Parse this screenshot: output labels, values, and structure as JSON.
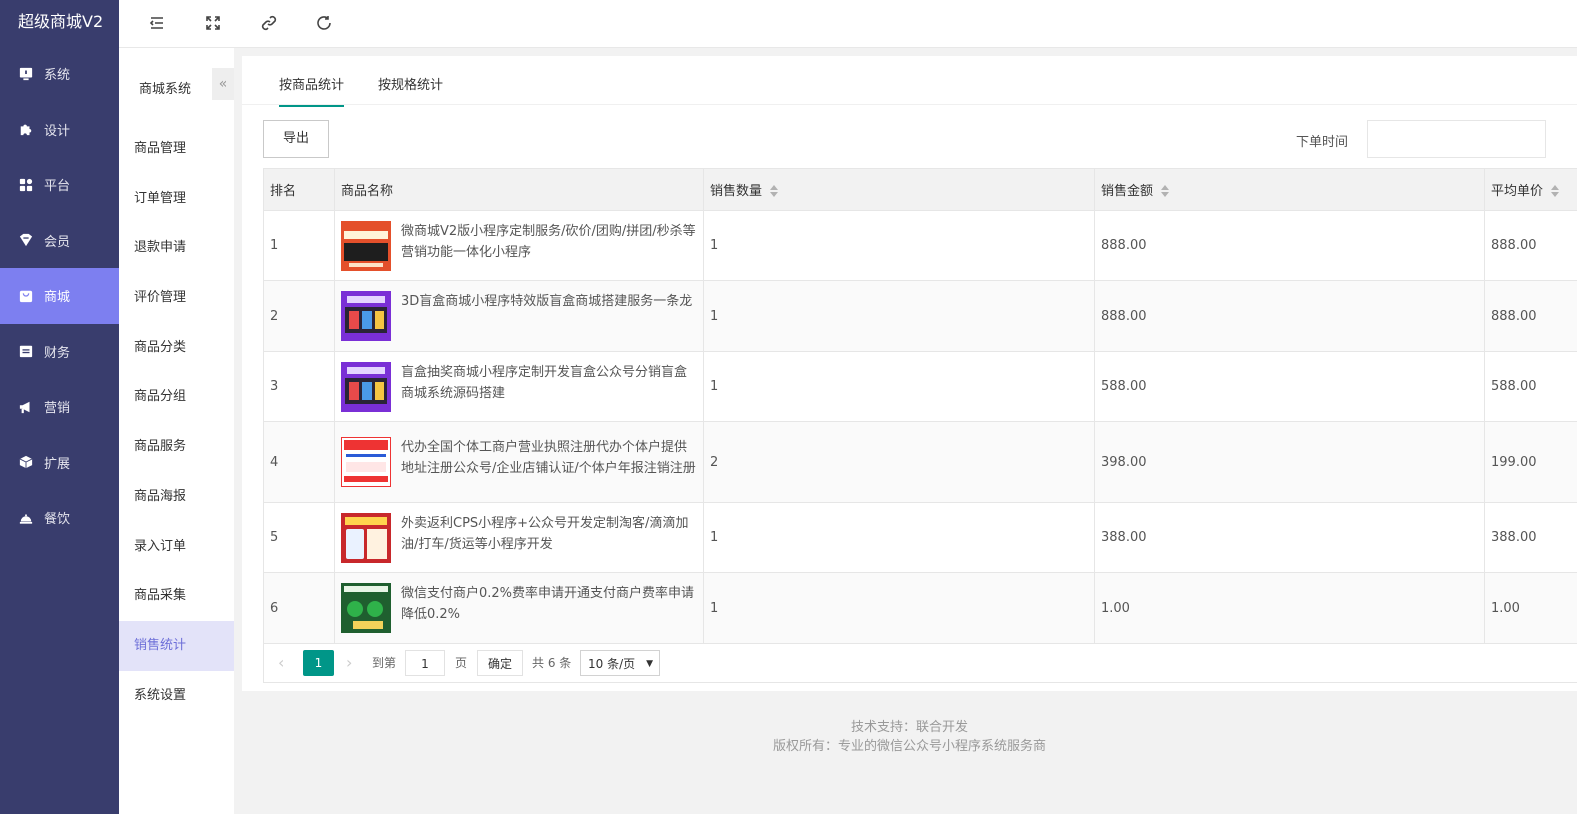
{
  "app": {
    "title": "超级商城V2"
  },
  "nav": [
    {
      "label": "系统",
      "icon": "monitor-icon"
    },
    {
      "label": "设计",
      "icon": "puzzle-icon"
    },
    {
      "label": "平台",
      "icon": "grid-icon"
    },
    {
      "label": "会员",
      "icon": "tag-icon"
    },
    {
      "label": "商城",
      "icon": "shop-icon",
      "active": true
    },
    {
      "label": "财务",
      "icon": "wallet-icon"
    },
    {
      "label": "营销",
      "icon": "megaphone-icon"
    },
    {
      "label": "扩展",
      "icon": "cube-icon"
    },
    {
      "label": "餐饮",
      "icon": "cloche-icon"
    }
  ],
  "topbar": {
    "icons": [
      "menu-fold-icon",
      "fullscreen-icon",
      "link-icon",
      "refresh-icon"
    ]
  },
  "subnav": {
    "title": "商城系统",
    "collapse_glyph": "«",
    "items": [
      "商品管理",
      "订单管理",
      "退款申请",
      "评价管理",
      "商品分类",
      "商品分组",
      "商品服务",
      "商品海报",
      "录入订单",
      "商品采集",
      "销售统计",
      "系统设置"
    ],
    "active_index": 10
  },
  "tabs": [
    "按商品统计",
    "按规格统计"
  ],
  "toolbar": {
    "export_label": "导出",
    "date_label": "下单时间",
    "date_value": ""
  },
  "table": {
    "headers": [
      "排名",
      "商品名称",
      "销售数量",
      "销售金额",
      "平均单价"
    ],
    "rows": [
      {
        "rank": "1",
        "name": "微商城V2版小程序定制服务/砍价/团购/拼团/秒杀等营销功能一体化小程序",
        "qty": "1",
        "amount": "888.00",
        "avg": "888.00",
        "thumb": "orange"
      },
      {
        "rank": "2",
        "name": "3D盲盒商城小程序特效版盲盒商城搭建服务一条龙",
        "qty": "1",
        "amount": "888.00",
        "avg": "888.00",
        "thumb": "purple"
      },
      {
        "rank": "3",
        "name": "盲盒抽奖商城小程序定制开发盲盒公众号分销盲盒商城系统源码搭建",
        "qty": "1",
        "amount": "588.00",
        "avg": "588.00",
        "thumb": "purple"
      },
      {
        "rank": "4",
        "name": "代办全国个体工商户营业执照注册代办个体户提供地址注册公众号/企业店铺认证/个体户年报注销注册",
        "qty": "2",
        "amount": "398.00",
        "avg": "199.00",
        "thumb": "white-red"
      },
      {
        "rank": "5",
        "name": "外卖返利CPS小程序+公众号开发定制淘客/滴滴加油/打车/货运等小程序开发",
        "qty": "1",
        "amount": "388.00",
        "avg": "388.00",
        "thumb": "red"
      },
      {
        "rank": "6",
        "name": "微信支付商户0.2%费率申请开通支付商户费率申请降低0.2%",
        "qty": "1",
        "amount": "1.00",
        "avg": "1.00",
        "thumb": "green"
      }
    ]
  },
  "pager": {
    "current": "1",
    "goto_label": "到第",
    "goto_value": "1",
    "page_label": "页",
    "confirm_label": "确定",
    "total_label": "共 6 条",
    "size_label": "10 条/页"
  },
  "footer": {
    "line1": "技术支持：联合开发",
    "line2": "版权所有：专业的微信公众号小程序系统服务商"
  }
}
